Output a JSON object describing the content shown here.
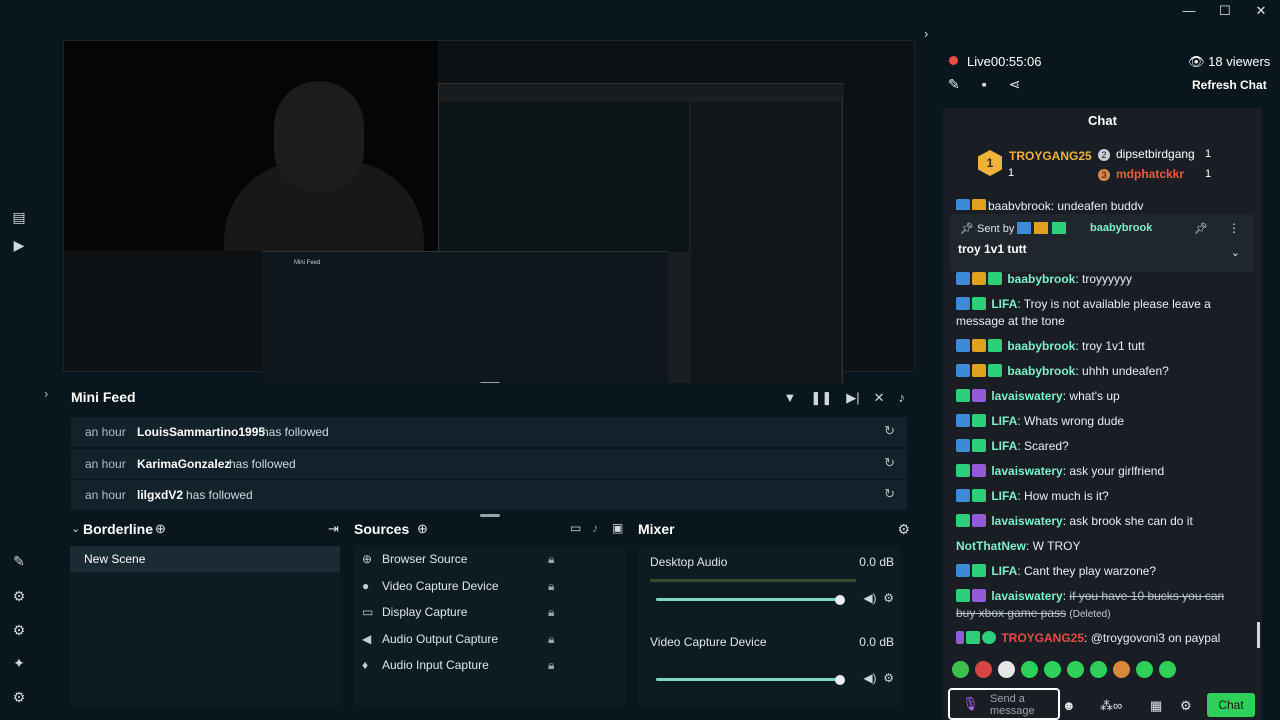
{
  "window": {
    "minimize": "—",
    "maximize": "☐",
    "close": "✕"
  },
  "mini_feed": {
    "title": "Mini Feed",
    "rows": [
      {
        "time": "an hour",
        "name": "LouisSammartino1995",
        "action": "has followed"
      },
      {
        "time": "an hour",
        "name": "KarimaGonzalez",
        "action": "has followed"
      },
      {
        "time": "an hour",
        "name": "lilgxdV2",
        "action": "has followed"
      }
    ]
  },
  "scenes": {
    "title": "Borderline",
    "items": [
      "New Scene"
    ]
  },
  "sources": {
    "title": "Sources",
    "items": [
      "Browser Source",
      "Video Capture Device",
      "Display Capture",
      "Audio Output Capture",
      "Audio Input Capture"
    ]
  },
  "mixer": {
    "title": "Mixer",
    "channels": [
      {
        "name": "Desktop Audio",
        "db": "0.0 dB",
        "level": 1.0
      },
      {
        "name": "Video Capture Device",
        "db": "0.0 dB",
        "level": 1.0
      }
    ]
  },
  "stream": {
    "status": "Live",
    "time": "00:55:06",
    "viewers": "18 viewers",
    "refresh": "Refresh Chat"
  },
  "chat": {
    "title": "Chat",
    "leaderboard": [
      {
        "rank": "1",
        "name": "TROYGANG25",
        "value": "1"
      },
      {
        "rank": "2",
        "name": "dipsetbirdgang",
        "value": "1"
      },
      {
        "rank": "3",
        "name": "mdphatckkr",
        "value": "1"
      }
    ],
    "partial_top": "baabybrook: undeafen buddy",
    "pinned": {
      "sent_by": "Sent by",
      "user": "baabybrook",
      "message": "troy 1v1 tutt"
    },
    "messages": [
      {
        "user": "baabybrook",
        "text": "troyyyyyy"
      },
      {
        "user": "LIFA",
        "text": "Troy is not available please leave a message at the tone"
      },
      {
        "user": "baabybrook",
        "text": "troy 1v1 tutt"
      },
      {
        "user": "baabybrook",
        "text": "uhhh undeafen?"
      },
      {
        "user": "lavaiswatery",
        "text": "what's up"
      },
      {
        "user": "LIFA",
        "text": "Whats wrong dude"
      },
      {
        "user": "LIFA",
        "text": "Scared?"
      },
      {
        "user": "lavaiswatery",
        "text": "ask your girlfriend"
      },
      {
        "user": "LIFA",
        "text": "How much is it?"
      },
      {
        "user": "lavaiswatery",
        "text": "ask brook she can do it"
      },
      {
        "user": "NotThatNew",
        "text": "W TROY"
      },
      {
        "user": "LIFA",
        "text": "Cant they play warzone?"
      },
      {
        "user": "lavaiswatery",
        "text": "if you have 10 bucks you can buy xbox game pass",
        "note": "(Deleted)"
      },
      {
        "user": "TROYGANG25",
        "text": "@troygovoni3 on paypal"
      }
    ],
    "composer_placeholder": "Send a message",
    "send_label": "Chat"
  },
  "colors": {
    "accent": "#2fd05a",
    "user_green": "#7ff0c7",
    "live_red": "#f04b48",
    "gold": "#f0b23a"
  }
}
